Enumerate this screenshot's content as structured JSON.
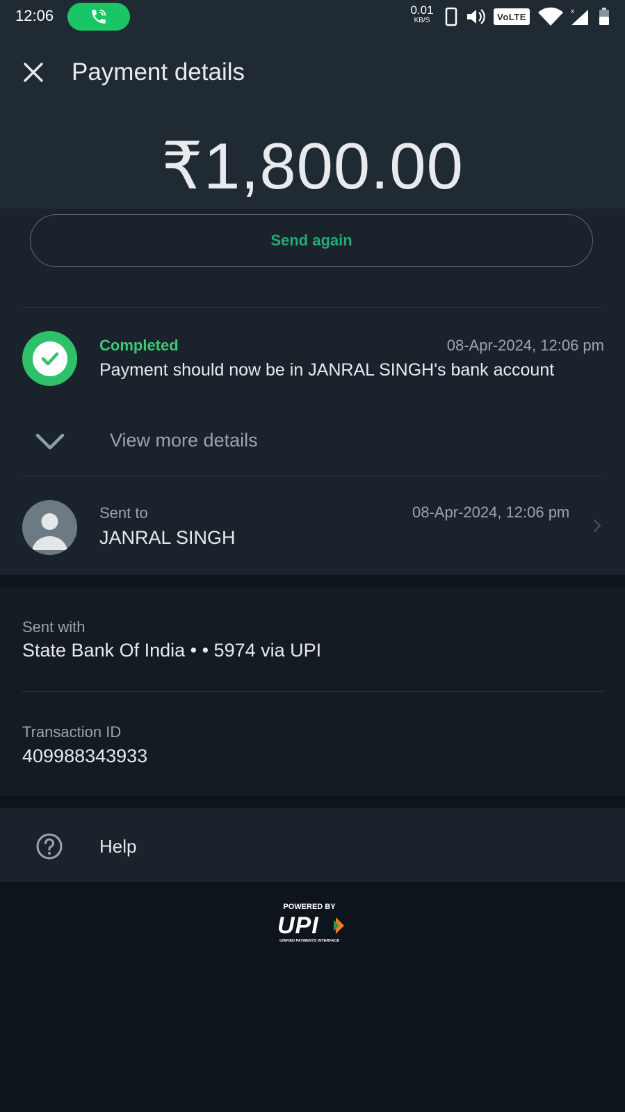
{
  "status_bar": {
    "time": "12:06",
    "net_speed_value": "0.01",
    "net_speed_unit": "KB/S",
    "volte": "VoLTE"
  },
  "header": {
    "title": "Payment details",
    "amount": "₹1,800.00"
  },
  "actions": {
    "send_again": "Send again"
  },
  "status": {
    "label": "Completed",
    "date": "08-Apr-2024, 12:06 pm",
    "message": "Payment should now be in JANRAL SINGH's bank account",
    "view_more": "View more details"
  },
  "recipient": {
    "label": "Sent to",
    "name": "JANRAL SINGH",
    "date": "08-Apr-2024, 12:06 pm"
  },
  "details": {
    "sent_with_label": "Sent with",
    "sent_with_value": "State Bank Of India • • 5974 via UPI",
    "txn_label": "Transaction ID",
    "txn_value": "409988343933"
  },
  "help": {
    "label": "Help"
  },
  "footer": {
    "powered_by": "POWERED BY",
    "logo": "UPI",
    "subtitle": "UNIFIED PAYMENTS INTERFACE"
  },
  "colors": {
    "header_bg": "#1f2a33",
    "accent_green": "#2fc16a",
    "button_text": "#1fae74"
  }
}
